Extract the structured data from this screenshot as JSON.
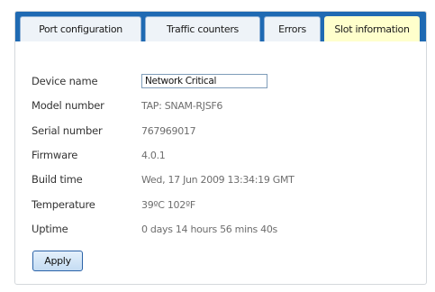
{
  "tabs": [
    {
      "label": "Port configuration",
      "active": false
    },
    {
      "label": "Traffic counters",
      "active": false
    },
    {
      "label": "Errors",
      "active": false
    },
    {
      "label": "Slot information",
      "active": true
    }
  ],
  "fields": {
    "device_name": {
      "label": "Device name",
      "value": "Network Critical"
    },
    "model_number": {
      "label": "Model number",
      "value": "TAP: SNAM-RJSF6"
    },
    "serial_number": {
      "label": "Serial number",
      "value": "767969017"
    },
    "firmware": {
      "label": "Firmware",
      "value": "4.0.1"
    },
    "build_time": {
      "label": "Build time",
      "value": "Wed, 17 Jun 2009 13:34:19 GMT"
    },
    "temperature": {
      "label": "Temperature",
      "value": "39ºC 102ºF"
    },
    "uptime": {
      "label": "Uptime",
      "value": "0 days 14 hours 56 mins 40s"
    }
  },
  "apply_button": {
    "label": "Apply"
  },
  "colors": {
    "tabbar": "#1f6ab3",
    "active_tab": "#ffffcc",
    "inactive_tab": "#eef3f8"
  }
}
